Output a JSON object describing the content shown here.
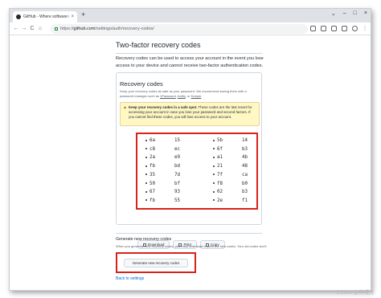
{
  "browser": {
    "tab_title": "GitHub - Where software i",
    "tab_close": "×",
    "new_tab": "+",
    "window_controls": [
      "⌄",
      "–",
      "□",
      "×"
    ],
    "nav": {
      "back": "←",
      "forward": "→",
      "reload": "C",
      "home": "⌂"
    },
    "url_scheme": "https://",
    "url_host": "github.com",
    "url_path": "/settings/auth/recovery-codes/",
    "menu": "⋮"
  },
  "page": {
    "title": "Two-factor recovery codes",
    "intro": "Recovery codes can be used to access your account in the event you lose access to your device and cannot receive two-factor authentication codes."
  },
  "recovery_box": {
    "title": "Recovery codes",
    "desc_pre": "Keep your recovery codes as safe as your password. We recommend saving them with a password manager such as ",
    "pm1": "1Password",
    "pm2": "Authy",
    "pm_or": ", or ",
    "pm3": "Keeper",
    "desc_end": ".",
    "warning_bold": "Keep your recovery codes in a safe spot.",
    "warning_rest": " These codes are the last resort for accessing your account in case you lose your password and second factors. If you cannot find these codes, you will lose access to your account.",
    "codes_left": [
      "6a",
      "c8",
      "2a",
      "fb",
      "35",
      "50",
      "67",
      "fb"
    ],
    "codes_left_2": [
      "15",
      "ec",
      "e9",
      "bd",
      "7d",
      "bf",
      "93",
      "55"
    ],
    "codes_right": [
      "5b",
      "6f",
      "a1",
      "21",
      "7f",
      "f8",
      "02",
      "2e"
    ],
    "codes_right_2": [
      "14",
      "b3",
      "4b",
      "48",
      "ca",
      "b0",
      "b3",
      "f1"
    ],
    "download": "Download",
    "print": "Print",
    "copy": "Copy"
  },
  "generate": {
    "title": "Generate new recovery codes",
    "desc": "When you generate new recovery codes, you must download or print the new codes. Your old codes won't",
    "button": "Generate new recovery codes"
  },
  "back_link": "Back to settings",
  "watermark": "CSDN @韩曙亮",
  "colors": {
    "highlight": "#d9211c",
    "warning_bg": "#fff8c5",
    "link": "#0969da"
  }
}
